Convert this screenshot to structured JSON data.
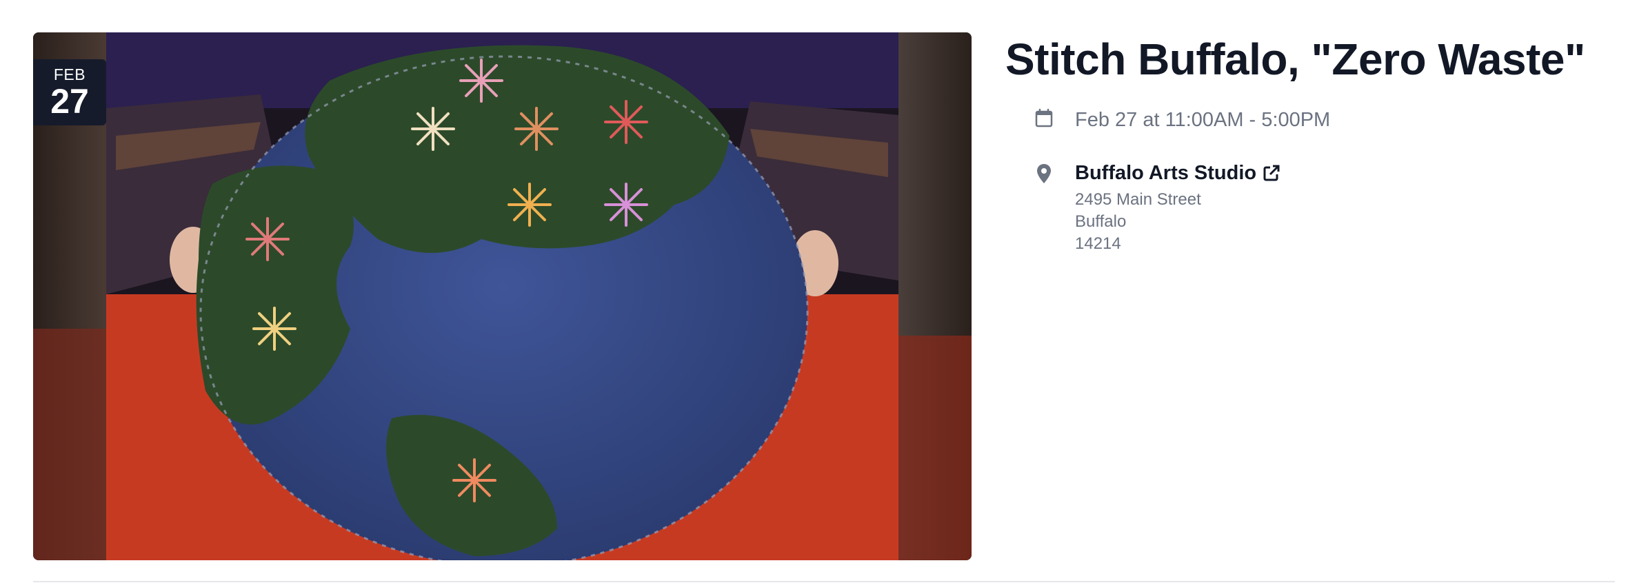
{
  "event": {
    "title": "Stitch Buffalo, \"Zero Waste\"",
    "date_badge": {
      "month": "FEB",
      "day": "27"
    },
    "when": "Feb 27 at 11:00AM - 5:00PM",
    "venue": {
      "name": "Buffalo Arts Studio",
      "street": "2495 Main Street",
      "city": "Buffalo",
      "zip": "14214"
    }
  },
  "icons": {
    "calendar": "calendar-icon",
    "location": "map-pin-icon",
    "external": "external-link-icon"
  },
  "colors": {
    "title": "#121826",
    "muted": "#6b7280",
    "badge_bg": "#151b2b",
    "icon": "#6b7280",
    "divider": "#e5e7eb"
  }
}
